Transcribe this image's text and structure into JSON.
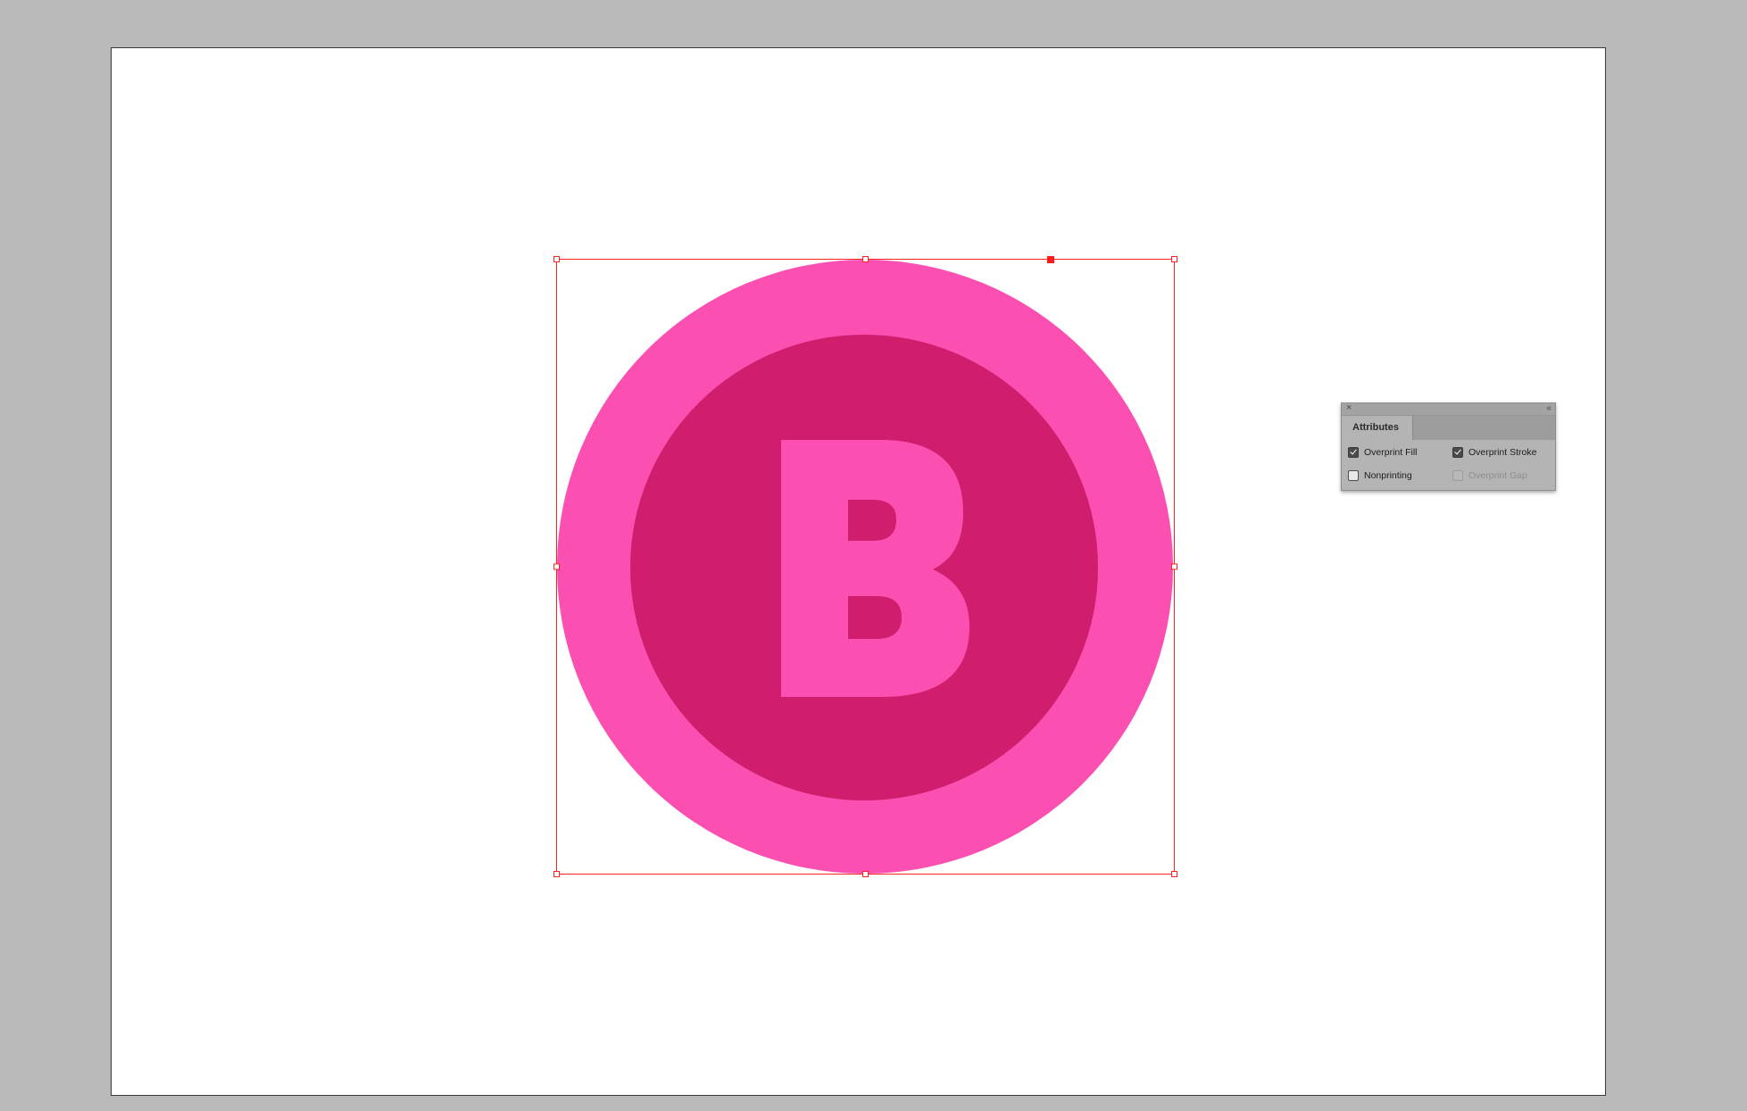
{
  "canvas": {
    "background_color": "#bababa",
    "artboard_color": "#ffffff"
  },
  "artwork": {
    "outer_circle_color": "#fb50b1",
    "inner_circle_color": "#d01d6d",
    "letter": "B",
    "letter_color": "#fb50b1",
    "selection_color": "#ff2020"
  },
  "attributes_panel": {
    "close_glyph": "×",
    "collapse_glyph": "‹‹",
    "tab_label": "Attributes",
    "options": {
      "overprint_fill": {
        "label": "Overprint Fill",
        "checked": true,
        "enabled": true
      },
      "overprint_stroke": {
        "label": "Overprint Stroke",
        "checked": true,
        "enabled": true
      },
      "nonprinting": {
        "label": "Nonprinting",
        "checked": false,
        "enabled": true
      },
      "overprint_gap": {
        "label": "Overprint Gap",
        "checked": false,
        "enabled": false
      }
    }
  }
}
